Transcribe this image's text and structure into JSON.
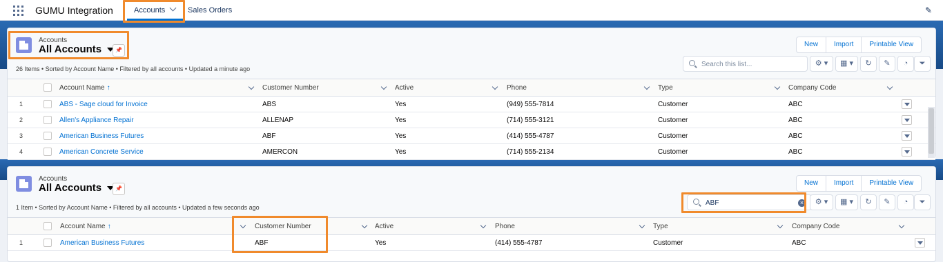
{
  "app": {
    "name": "GUMU Integration"
  },
  "nav": {
    "tabs": [
      {
        "label": "Accounts"
      },
      {
        "label": "Sales Orders"
      }
    ]
  },
  "panel1": {
    "object_label": "Accounts",
    "list_view": "All Accounts",
    "info": "26 Items • Sorted by Account Name • Filtered by all accounts • Updated a minute ago",
    "buttons": {
      "new": "New",
      "import": "Import",
      "printable": "Printable View"
    },
    "search": {
      "placeholder": "Search this list...",
      "value": ""
    },
    "columns": [
      "Account Name",
      "Customer Number",
      "Active",
      "Phone",
      "Type",
      "Company Code"
    ],
    "sort_indicator": "↑",
    "rows": [
      {
        "num": "1",
        "name": "ABS - Sage cloud for Invoice",
        "customer_number": "ABS",
        "active": "Yes",
        "phone": "(949) 555-7814",
        "type": "Customer",
        "company_code": "ABC"
      },
      {
        "num": "2",
        "name": "Allen's Appliance Repair",
        "customer_number": "ALLENAP",
        "active": "Yes",
        "phone": "(714) 555-3121",
        "type": "Customer",
        "company_code": "ABC"
      },
      {
        "num": "3",
        "name": "American Business Futures",
        "customer_number": "ABF",
        "active": "Yes",
        "phone": "(414) 555-4787",
        "type": "Customer",
        "company_code": "ABC"
      },
      {
        "num": "4",
        "name": "American Concrete Service",
        "customer_number": "AMERCON",
        "active": "Yes",
        "phone": "(714) 555-2134",
        "type": "Customer",
        "company_code": "ABC"
      }
    ]
  },
  "panel2": {
    "object_label": "Accounts",
    "list_view": "All Accounts",
    "info": "1 Item • Sorted by Account Name • Filtered by all accounts • Updated a few seconds ago",
    "buttons": {
      "new": "New",
      "import": "Import",
      "printable": "Printable View"
    },
    "search": {
      "placeholder": "Search this list...",
      "value": "ABF"
    },
    "columns": [
      "Account Name",
      "Customer Number",
      "Active",
      "Phone",
      "Type",
      "Company Code"
    ],
    "sort_indicator": "↑",
    "rows": [
      {
        "num": "1",
        "name": "American Business Futures",
        "customer_number": "ABF",
        "active": "Yes",
        "phone": "(414) 555-4787",
        "type": "Customer",
        "company_code": "ABC"
      }
    ]
  },
  "icons": {
    "gear": "⚙",
    "table": "▦",
    "refresh": "↻",
    "edit": "✎",
    "chart": "◔",
    "filter": "⏷",
    "pin": "📌",
    "clear": "×"
  },
  "colors": {
    "accent": "#0070d2",
    "highlight": "#f08a2c",
    "brand": "#174a86"
  }
}
